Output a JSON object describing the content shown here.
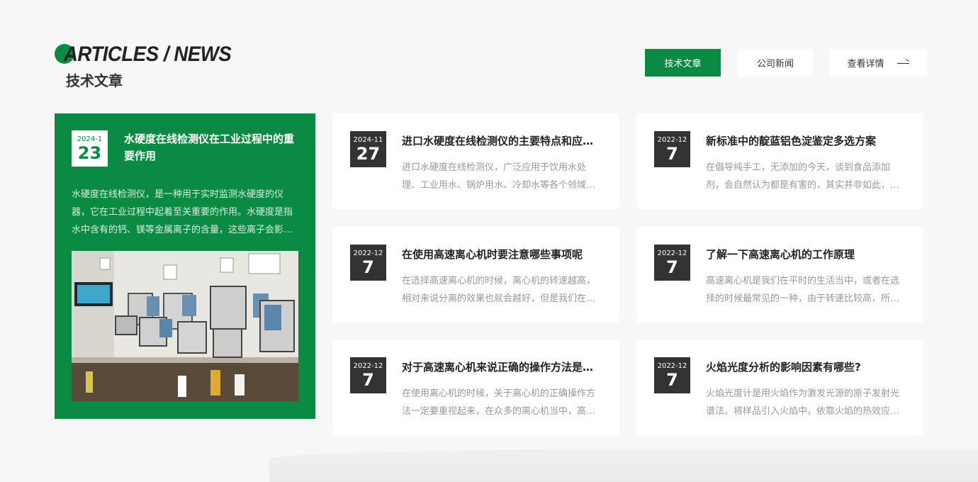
{
  "header": {
    "en_title": "ARTICLES / NEWS",
    "cn_title": "技术文章"
  },
  "tabs": [
    {
      "label": "技术文章",
      "active": true
    },
    {
      "label": "公司新闻",
      "active": false
    },
    {
      "label": "查看详情",
      "active": false
    }
  ],
  "featured": {
    "date_ym": "2024-1",
    "date_d": "23",
    "title": "水硬度在线检测仪在工业过程中的重要作用",
    "desc": "水硬度在线检测仪，是一种用于实时监测水硬度的仪器，它在工业过程中起着至关重要的作用。水硬度是指水中含有的钙、镁等金属离子的含量，这些离子会影响工业生产"
  },
  "cards": [
    {
      "date_ym": "2024-11",
      "date_d": "27",
      "title": "进口水硬度在线检测仪的主要特点和应用领域",
      "desc": "进口水硬度在线检测仪，广泛应用于饮用水处理、工业用水、锅炉用水、冷却水等各个领域的水质监测"
    },
    {
      "date_ym": "2022-12",
      "date_d": "7",
      "title": "新标准中的靛蓝铝色淀鉴定多选方案",
      "desc": "在倡导纯手工，无添加的今天，谈到食品添加剂，会自然认为都是有害的，其实并非如此，食品添加剂"
    },
    {
      "date_ym": "2022-12",
      "date_d": "7",
      "title": "在使用高速离心机时要注意哪些事项呢",
      "desc": "在选择高速离心机的时候，离心机的转速越高，相对来说分离的效果也就会越好，但是我们在使用的过程中"
    },
    {
      "date_ym": "2022-12",
      "date_d": "7",
      "title": "了解一下高速离心机的工作原理",
      "desc": "高速离心机是我们在平时的生活当中，或者在选择的时候最常见的一种，由于转速比较高，所以在使用的时候"
    },
    {
      "date_ym": "2022-12",
      "date_d": "7",
      "title": "对于高速离心机来说正确的操作方法是非常重要的",
      "desc": "在使用离心机的时候，关于离心机的正确操作方法一定要重视起来，在众多的离心机当中，高速离心机的使用"
    },
    {
      "date_ym": "2022-12",
      "date_d": "7",
      "title": "火焰光度分析的影响因素有哪些?",
      "desc": "火焰光度计是用火焰作为激发光源的原子发射光谱法。将样品引入火焰中，依靠火焰的热效应使待测元素"
    }
  ],
  "colors": {
    "accent": "#0a8a42",
    "dark_badge": "#333333"
  }
}
